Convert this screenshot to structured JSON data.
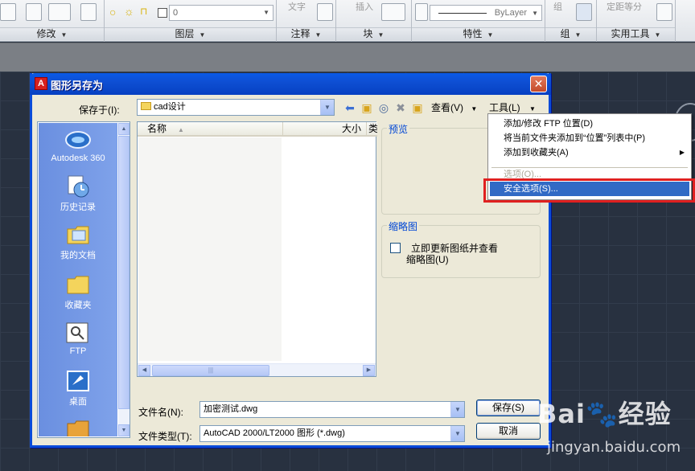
{
  "ribbon": {
    "panels": [
      {
        "id": "modify",
        "title": "修改"
      },
      {
        "id": "layers",
        "title": "图层"
      },
      {
        "id": "annotation",
        "title": "注释"
      },
      {
        "id": "block",
        "title": "块"
      },
      {
        "id": "properties",
        "title": "特性"
      },
      {
        "id": "groups",
        "title": "组"
      },
      {
        "id": "utilities",
        "title": "实用工具"
      }
    ],
    "layer_value": "0",
    "annotation_top": "文字",
    "block_top": "插入",
    "groups_top": "组",
    "utilities_top": "定距等分",
    "linetype_value": "ByLayer",
    "expand_arrow": "▼"
  },
  "dialog": {
    "title": "图形另存为",
    "close_label": "✕",
    "save_in_label": "保存于(I):",
    "save_in_value": "cad设计",
    "views_menu": "查看(V)",
    "tools_menu": "工具(L)",
    "menu_arrow": "▼",
    "toolbar_icons": [
      "back-icon",
      "up-folder-icon",
      "search-web-icon",
      "delete-icon",
      "new-folder-icon"
    ],
    "places": [
      {
        "id": "autodesk360",
        "label": "Autodesk 360",
        "icon": "cloud-icon"
      },
      {
        "id": "history",
        "label": "历史记录",
        "icon": "clock-icon"
      },
      {
        "id": "documents",
        "label": "我的文档",
        "icon": "documents-icon"
      },
      {
        "id": "favorites",
        "label": "收藏夹",
        "icon": "folder-icon"
      },
      {
        "id": "ftp",
        "label": "FTP",
        "icon": "ftp-icon"
      },
      {
        "id": "desktop",
        "label": "桌面",
        "icon": "desktop-icon"
      }
    ],
    "columns": {
      "name": "名称",
      "size": "大小",
      "type": "类"
    },
    "sort_arrow": "▲",
    "preview_label": "预览",
    "thumbnail_group": "缩略图",
    "thumbnail_checkbox_line1": "立即更新图纸并查看",
    "thumbnail_checkbox_line2": "缩略图(U)",
    "filename_label": "文件名(N):",
    "filename_value": "加密测试.dwg",
    "filetype_label": "文件类型(T):",
    "filetype_value": "AutoCAD 2000/LT2000 图形 (*.dwg)",
    "save_button": "保存(S)",
    "cancel_button": "取消",
    "scroll_grip": "|||"
  },
  "tools_menu_items": [
    {
      "label": "添加/修改 FTP 位置(D)",
      "disabled": false
    },
    {
      "label": "将当前文件夹添加到“位置”列表中(P)",
      "disabled": false
    },
    {
      "label": "添加到收藏夹(A)",
      "disabled": false,
      "submenu": true
    },
    {
      "label": "选项(O)...",
      "disabled": true
    },
    {
      "label": "安全选项(S)...",
      "disabled": false,
      "highlighted": true
    }
  ],
  "submenu_arrow": "▶",
  "watermark": {
    "logo": "Bai🐾经验",
    "url": "jingyan.baidu.com"
  },
  "colors": {
    "titlebar": "#0a4bd9",
    "highlight": "#316ac5",
    "annotation_box": "#e02020",
    "canvas": "#283140"
  }
}
